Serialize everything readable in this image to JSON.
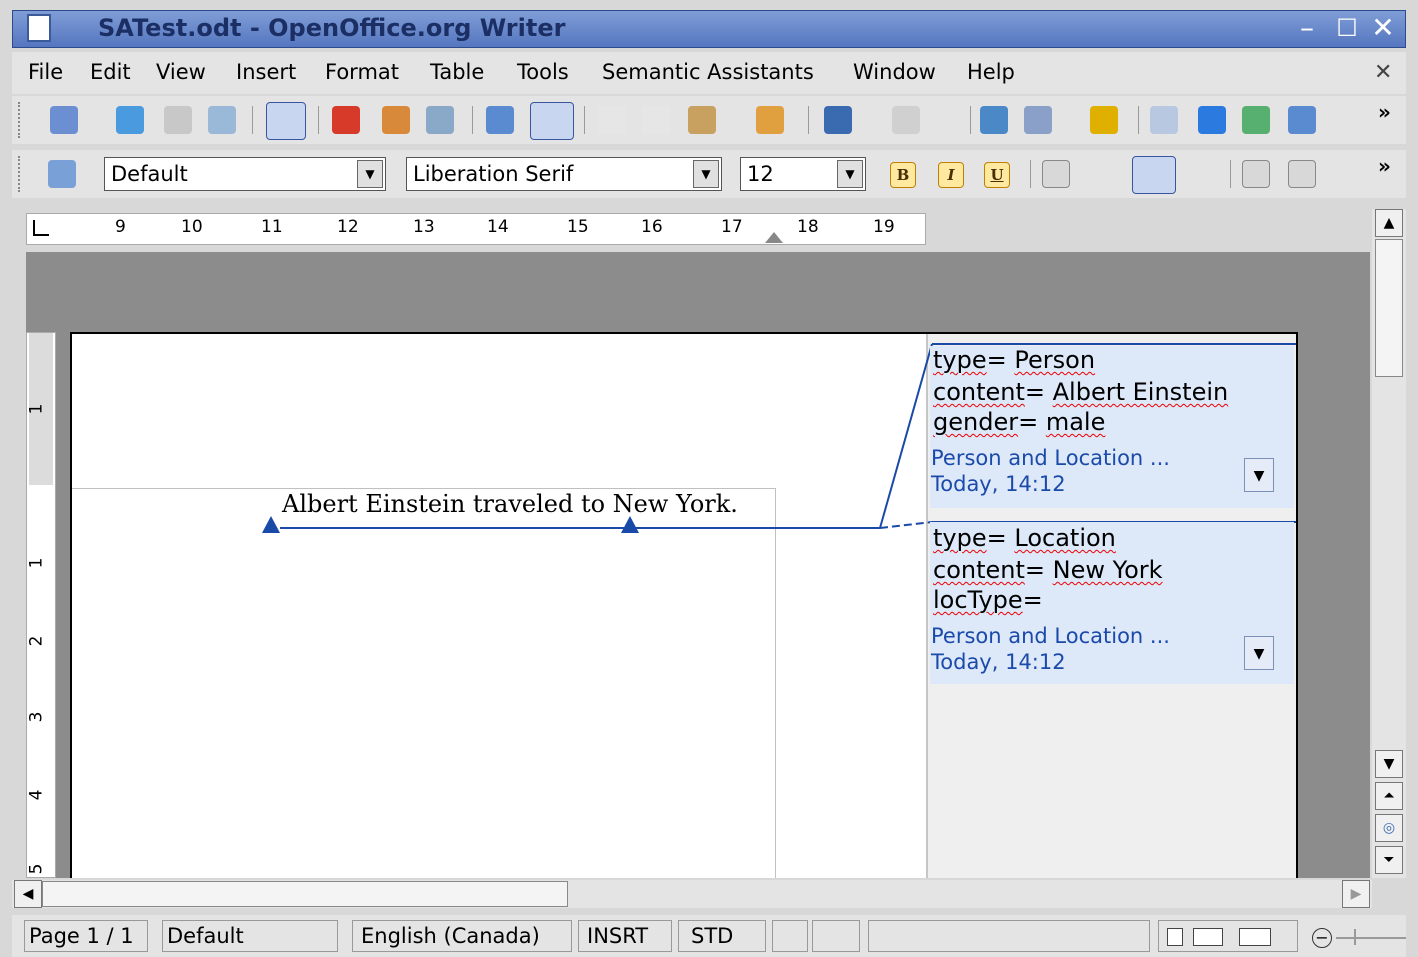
{
  "window": {
    "title": "SATest.odt - OpenOffice.org Writer",
    "buttons": {
      "minimize": "–",
      "maximize": "☐",
      "close": "✕"
    }
  },
  "menu": {
    "items": [
      "File",
      "Edit",
      "View",
      "Insert",
      "Format",
      "Table",
      "Tools",
      "Semantic Assistants",
      "Window",
      "Help"
    ],
    "close_doc": "✕"
  },
  "formatting": {
    "paragraph_style": "Default",
    "font_name": "Liberation Serif",
    "font_size": "12",
    "bold": "B",
    "italic": "I",
    "underline": "U"
  },
  "ruler": {
    "numbers": [
      "9",
      "10",
      "11",
      "12",
      "13",
      "14",
      "15",
      "16",
      "17",
      "18",
      "19"
    ],
    "vertical_numbers": [
      "1",
      "1",
      "2",
      "3",
      "4",
      "5"
    ]
  },
  "document": {
    "text": "Albert Einstein traveled to New York."
  },
  "comments": [
    {
      "lines": [
        {
          "key": "type",
          "sep": "= ",
          "value": "Person"
        },
        {
          "key": "content",
          "sep": "= ",
          "value": "Albert Einstein"
        },
        {
          "key": "gender",
          "sep": "= ",
          "value": "male"
        }
      ],
      "author": "Person and Location ...",
      "date": "Today, 14:12"
    },
    {
      "lines": [
        {
          "key": "type",
          "sep": "= ",
          "value": "Location"
        },
        {
          "key": "content",
          "sep": "= ",
          "value": "New York"
        },
        {
          "key": "locType",
          "sep": "=",
          "value": ""
        }
      ],
      "author": "Person and Location ...",
      "date": "Today, 14:12"
    }
  ],
  "statusbar": {
    "page": "Page 1 / 1",
    "style": "Default",
    "language": "English (Canada)",
    "insert_mode": "INSRT",
    "selection_mode": "STD"
  },
  "colors": {
    "titlebar": "#5576c0",
    "comment_bg": "#dde8f9",
    "comment_meta": "#1a4aaa",
    "anchor_line": "#1a4aa8"
  }
}
